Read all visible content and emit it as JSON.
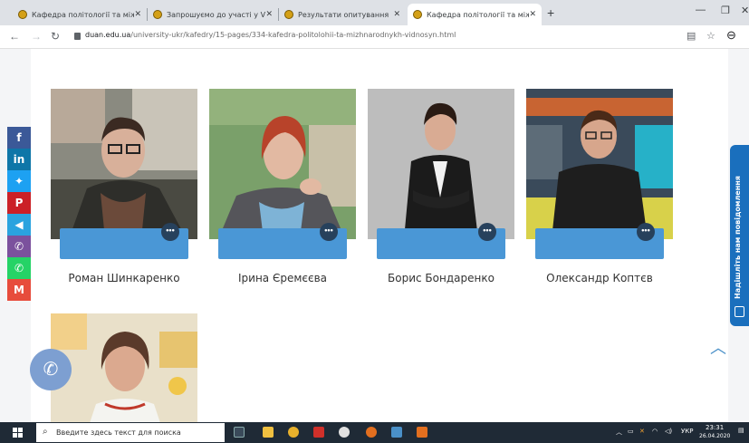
{
  "browser": {
    "tabs": [
      {
        "title": "Кафедра політології та міжнар",
        "active": false
      },
      {
        "title": "Запрошуємо до участі у V Всеу",
        "active": false
      },
      {
        "title": "Результати опитування",
        "active": false
      },
      {
        "title": "Кафедра політології та міжнар",
        "active": true
      }
    ],
    "url_host": "duan.edu.ua",
    "url_path": "/university-ukr/kafedry/15-pages/334-kafedra-politolohii-ta-mizhnarodnykh-vidnosyn.html"
  },
  "team": {
    "members": [
      {
        "name": "Роман Шинкаренко"
      },
      {
        "name": "Ірина Єремєєва"
      },
      {
        "name": "Борис Бондаренко"
      },
      {
        "name": "Олександр Коптєв"
      },
      {
        "name": ""
      }
    ],
    "more_label": "•••"
  },
  "share_sidebar": [
    {
      "icon": "facebook-icon",
      "glyph": "f",
      "color": "#3b5998"
    },
    {
      "icon": "linkedin-icon",
      "glyph": "in",
      "color": "#0e76a8"
    },
    {
      "icon": "twitter-icon",
      "glyph": "🐦",
      "color": "#1da1f2"
    },
    {
      "icon": "pinterest-icon",
      "glyph": "P",
      "color": "#cb2027"
    },
    {
      "icon": "telegram-icon",
      "glyph": "◀",
      "color": "#2aa3df"
    },
    {
      "icon": "viber-icon",
      "glyph": "✆",
      "color": "#7b519d"
    },
    {
      "icon": "whatsapp-icon",
      "glyph": "✆",
      "color": "#25d366"
    },
    {
      "icon": "gmail-icon",
      "glyph": "M",
      "color": "#e74c3c"
    }
  ],
  "feedback_tab": {
    "label": "Надішліть нам повідомлення"
  },
  "taskbar": {
    "search_placeholder": "Введите здесь текст для поиска",
    "lang": "УКР",
    "time": "23:31",
    "date": "26.04.2020"
  }
}
